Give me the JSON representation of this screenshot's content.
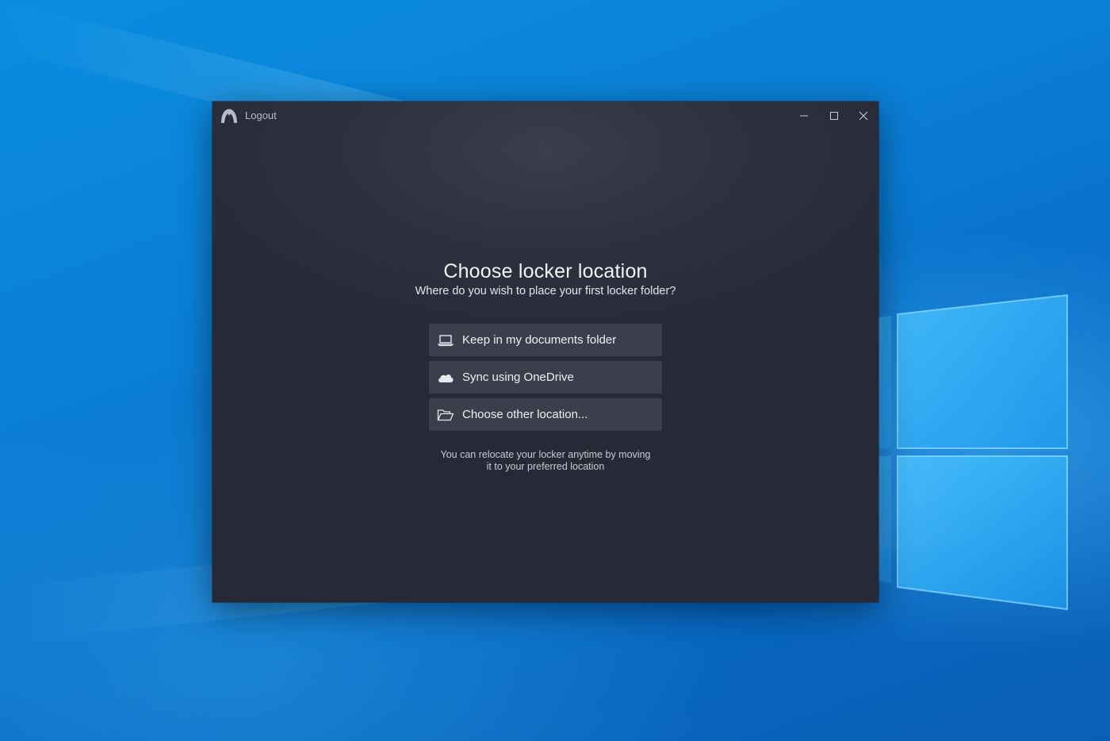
{
  "titlebar": {
    "label": "Logout",
    "app_icon": "logout-app-icon",
    "controls": [
      "minimize-icon",
      "maximize-icon",
      "close-icon"
    ]
  },
  "main": {
    "heading": "Choose locker location",
    "subheading": "Where do you wish to place your first locker folder?",
    "options": [
      {
        "icon": "laptop-icon",
        "label": "Keep in my documents folder"
      },
      {
        "icon": "cloud-icon",
        "label": "Sync using OneDrive"
      },
      {
        "icon": "folder-open-icon",
        "label": "Choose other location..."
      }
    ],
    "note_line1": "You can relocate your locker anytime by moving",
    "note_line2": "it to your preferred location"
  },
  "colors": {
    "desktop": "#0b7fd6",
    "window_bg": "#2e323e",
    "option_bg": "#3b3f4b",
    "text": "#eef0f4"
  }
}
